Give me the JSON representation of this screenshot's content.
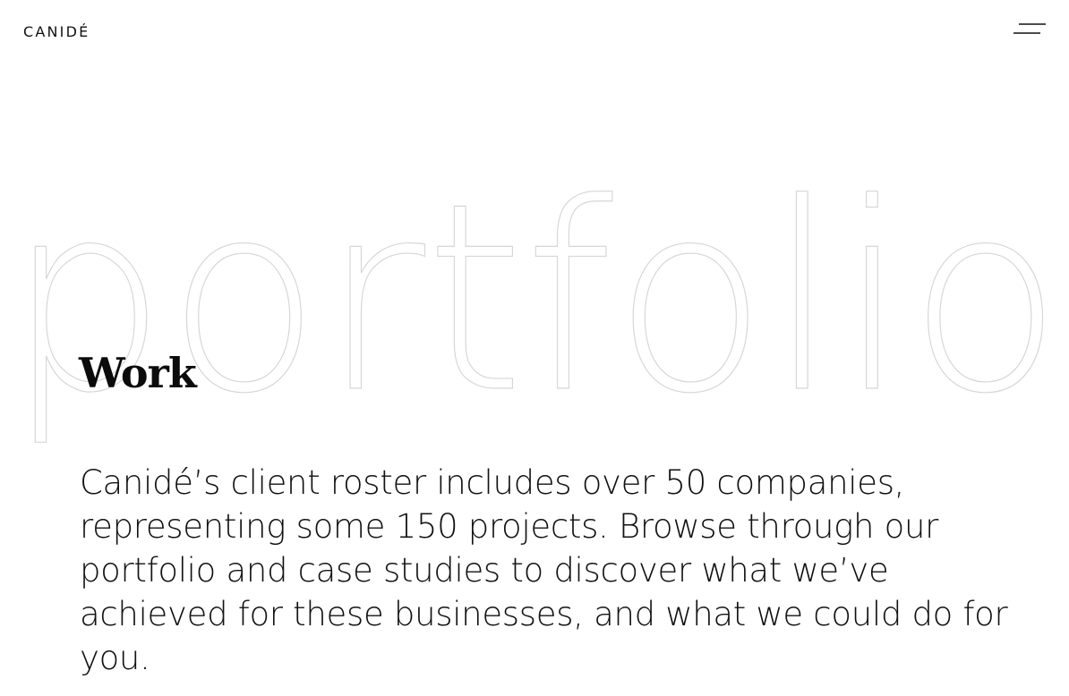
{
  "header": {
    "logo_text": "CANIDÉ",
    "menu_icon": "menu-icon"
  },
  "hero": {
    "background_word": "portfolio",
    "title": "Work",
    "description": "Canidé’s client roster includes over 50 companies, representing some 150 projects. Browse through our portfolio and case studies to discover what we’ve achieved for these businesses, and what we could do for you."
  },
  "colors": {
    "text": "#111111",
    "outline": "#d6d6d6",
    "background": "#ffffff"
  }
}
